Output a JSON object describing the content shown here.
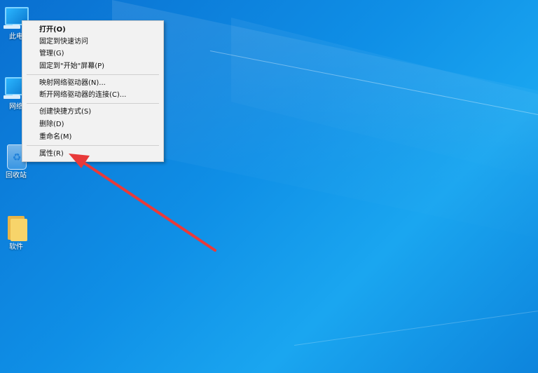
{
  "desktop": {
    "icons": [
      {
        "label": "此电",
        "icon": "computer-icon"
      },
      {
        "label": "网络",
        "icon": "network-icon"
      },
      {
        "label": "回收站",
        "icon": "recycle-bin-icon"
      },
      {
        "label": "软件",
        "icon": "folder-icon"
      }
    ]
  },
  "context_menu": {
    "items": [
      {
        "label": "打开(O)"
      },
      {
        "label": "固定到快速访问"
      },
      {
        "label": "管理(G)"
      },
      {
        "label": "固定到\"开始\"屏幕(P)"
      },
      {
        "label": "映射网络驱动器(N)..."
      },
      {
        "label": "断开网络驱动器的连接(C)..."
      },
      {
        "label": "创建快捷方式(S)"
      },
      {
        "label": "删除(D)"
      },
      {
        "label": "重命名(M)"
      },
      {
        "label": "属性(R)"
      }
    ]
  },
  "annotation": {
    "color": "#e83a3a"
  },
  "colors": {
    "wallpaper": "#0f8fe6",
    "menu_bg": "#f2f2f2"
  }
}
